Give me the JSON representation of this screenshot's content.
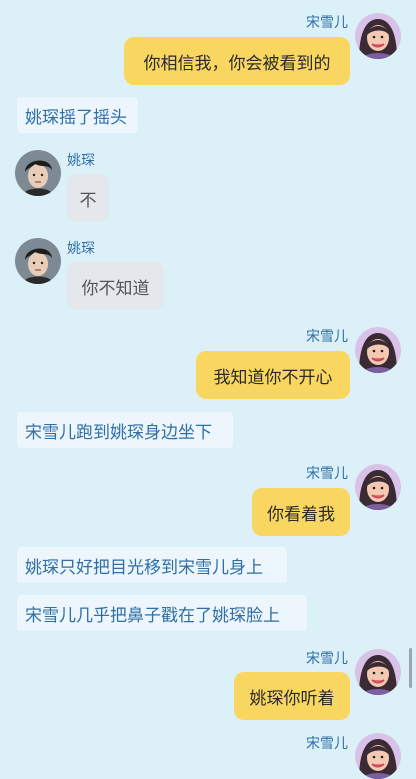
{
  "characters": {
    "song_xueer": "宋雪儿",
    "yao_shen": "姚琛"
  },
  "messages": [
    {
      "type": "right",
      "name": "宋雪儿",
      "text": "你相信我，你会被看到的"
    },
    {
      "type": "narration",
      "text": "姚琛摇了摇头"
    },
    {
      "type": "left",
      "name": "姚琛",
      "text": "不"
    },
    {
      "type": "left",
      "name": "姚琛",
      "text": "你不知道"
    },
    {
      "type": "right",
      "name": "宋雪儿",
      "text": "我知道你不开心"
    },
    {
      "type": "narration",
      "text": "宋雪儿跑到姚琛身边坐下"
    },
    {
      "type": "right",
      "name": "宋雪儿",
      "text": "你看着我"
    },
    {
      "type": "narration",
      "text": "姚琛只好把目光移到宋雪儿身上"
    },
    {
      "type": "narration",
      "text": "宋雪儿几乎把鼻子戳在了姚琛脸上"
    },
    {
      "type": "right",
      "name": "宋雪儿",
      "text": "姚琛你听着"
    },
    {
      "type": "right",
      "name": "宋雪儿",
      "text": ""
    }
  ],
  "colors": {
    "background": "#dcf0f8",
    "right_bubble": "#f8d660",
    "left_bubble": "#e4e8ec",
    "narration_bg": "#ecf6fc",
    "name_text": "#2f6fa6"
  },
  "icons": {
    "female_avatar": "avatar-female-icon",
    "male_avatar": "avatar-male-icon"
  }
}
